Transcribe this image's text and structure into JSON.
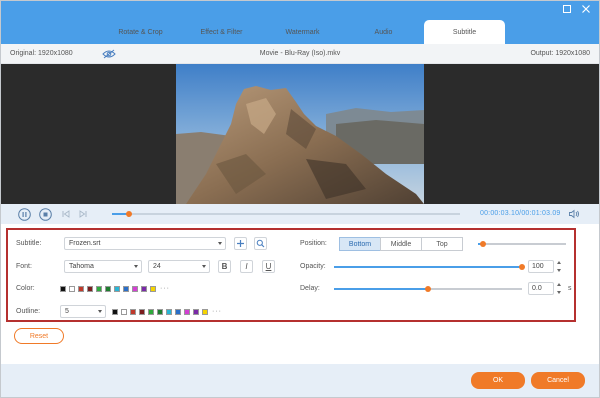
{
  "tabs": [
    {
      "label": "Rotate & Crop"
    },
    {
      "label": "Effect & Filter"
    },
    {
      "label": "Watermark"
    },
    {
      "label": "Audio"
    },
    {
      "label": "Subtitle",
      "active": true
    }
  ],
  "info": {
    "original": "Original: 1920x1080",
    "file_name": "Movie - Blu-Ray (Iso).mkv",
    "output": "Output: 1920x1080"
  },
  "playback": {
    "progress": 0.048,
    "timecode": "00:00:03.10/00:01:03.09"
  },
  "subtitle": {
    "label": "Subtitle:",
    "file": "Frozen.srt"
  },
  "font": {
    "label": "Font:",
    "family": "Tahoma",
    "size": "24",
    "bold": "B",
    "italic": "I",
    "underline": "U"
  },
  "color": {
    "label": "Color:",
    "swatches": [
      "#111111",
      "#ffffff",
      "#c0392b",
      "#7b1e1e",
      "#2eaa3c",
      "#1e7d2e",
      "#29b6d6",
      "#2a6fc9",
      "#d43fd4",
      "#7a2aa8",
      "#f5d400"
    ],
    "more": "···"
  },
  "outline": {
    "label": "Outline:",
    "value": "5",
    "swatches": [
      "#111111",
      "#ffffff",
      "#c0392b",
      "#7b1e1e",
      "#2eaa3c",
      "#1e7d2e",
      "#29b6d6",
      "#2a6fc9",
      "#d43fd4",
      "#7a2aa8",
      "#f5d400"
    ],
    "more": "···"
  },
  "position": {
    "label": "Position:",
    "options": [
      "Bottom",
      "Middle",
      "Top"
    ],
    "selected": "Bottom",
    "slider": 0.06
  },
  "opacity": {
    "label": "Opacity:",
    "value": "100",
    "slider": 1.0
  },
  "delay": {
    "label": "Delay:",
    "value": "0.0",
    "unit": "s",
    "slider": 0.5
  },
  "buttons": {
    "reset": "Reset",
    "ok": "OK",
    "cancel": "Cancel"
  },
  "colors": {
    "accent": "#4a9ee8",
    "orange": "#f07a28",
    "highlight_border": "#b5302f"
  }
}
